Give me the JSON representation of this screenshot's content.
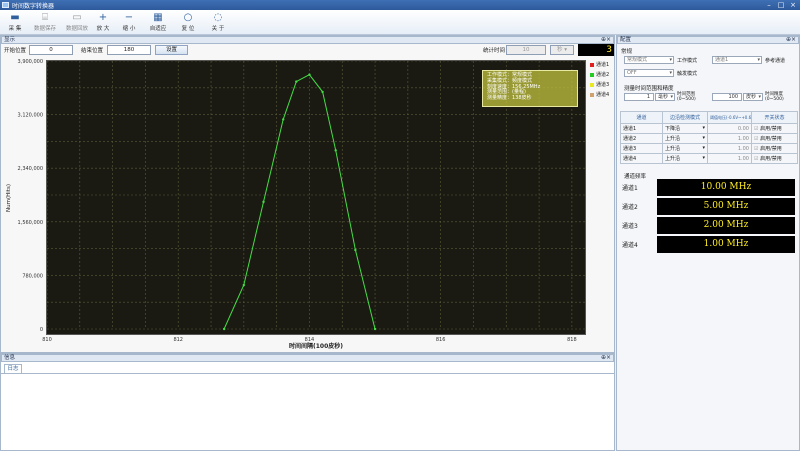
{
  "app": {
    "title": "时间数字转换器"
  },
  "toolbar": {
    "items": [
      {
        "label": "采 集",
        "icon": "acquire-icon",
        "enabled": true
      },
      {
        "label": "数据保存",
        "icon": "save-data-icon",
        "enabled": false
      },
      {
        "label": "数据回放",
        "icon": "playback-icon",
        "enabled": false
      },
      {
        "label": "放 大",
        "icon": "zoom-in-icon",
        "enabled": true
      },
      {
        "label": "缩 小",
        "icon": "zoom-out-icon",
        "enabled": true
      },
      {
        "label": "自适应",
        "icon": "auto-fit-icon",
        "enabled": true
      },
      {
        "label": "复 位",
        "icon": "reset-icon",
        "enabled": true
      },
      {
        "label": "关 于",
        "icon": "about-icon",
        "enabled": true
      }
    ]
  },
  "display": {
    "panel_title": "显示",
    "start_label": "开始位置",
    "start_value": "0",
    "end_label": "结束位置",
    "end_value": "180",
    "set_button": "设置",
    "stat_label": "统计时间",
    "stat_value": "10",
    "stat_unit": "秒",
    "counter": "3"
  },
  "legend": {
    "items": [
      {
        "label": "通道1",
        "color": "#e02020"
      },
      {
        "label": "通道2",
        "color": "#22cc22"
      },
      {
        "label": "通道3",
        "color": "#e8e820"
      },
      {
        "label": "通道4",
        "color": "#d0a070"
      }
    ]
  },
  "infobox": {
    "lines": [
      "工作模式：常规模式",
      "采集模式：频度模式",
      "刻度速度：156.25MHz",
      "测量范围：(量程)",
      "测量精度：138皮秒"
    ]
  },
  "chart_data": {
    "type": "line",
    "title": "",
    "xlabel": "时间间隔(100皮秒)",
    "ylabel": "Num(Hits)",
    "xlim": [
      810,
      818.2
    ],
    "ylim": [
      0,
      3900000
    ],
    "x_ticks": [
      "810",
      "812",
      "814",
      "816",
      "818"
    ],
    "y_ticks": [
      "0",
      "780,000",
      "1,560,000",
      "2,340,000",
      "3,120,000",
      "3,900,000"
    ],
    "grid": true,
    "series": [
      {
        "name": "通道2",
        "color": "#44dd44",
        "x": [
          812.7,
          813.0,
          813.3,
          813.6,
          813.8,
          814.0,
          814.2,
          814.4,
          814.7,
          815.0
        ],
        "y": [
          0,
          640000,
          1850000,
          3050000,
          3600000,
          3700000,
          3450000,
          2600000,
          1150000,
          0
        ]
      }
    ]
  },
  "info_panel": {
    "title": "信息",
    "tab": "日志"
  },
  "settings": {
    "panel_title": "配置",
    "general_label": "常规",
    "work_mode_value": "常规模式",
    "work_mode_label": "工作模式",
    "trigger_channel_value": "通道1",
    "trigger_channel_label": "参考通道",
    "trigger_mode_value": "OFF",
    "trigger_mode_label": "触发模式",
    "range_label": "测量时间范围和精度",
    "range_min": "1",
    "range_min_unit": "毫秒",
    "range_time_label": "时间范围",
    "range_time_sub": "(0~500)",
    "precision_value": "100",
    "precision_unit": "皮秒",
    "precision_label": "时间精度",
    "precision_sub": "(0~500)",
    "table_headers": [
      "通道",
      "边沿检测模式",
      "阈值电压(-0.6V~+0.6V)",
      "开关状态"
    ],
    "channels": [
      {
        "name": "通道1",
        "edge": "下降沿",
        "threshold": "0.00",
        "state": "启用/禁用"
      },
      {
        "name": "通道2",
        "edge": "上升沿",
        "threshold": "1.00",
        "state": "启用/禁用"
      },
      {
        "name": "通道3",
        "edge": "上升沿",
        "threshold": "1.00",
        "state": "启用/禁用"
      },
      {
        "name": "通道4",
        "edge": "上升沿",
        "threshold": "1.00",
        "state": "启用/禁用"
      }
    ],
    "freq_label": "通道频率",
    "freqs": [
      {
        "name": "通道1",
        "value": "10.00 MHz"
      },
      {
        "name": "通道2",
        "value": "5.00 MHz"
      },
      {
        "name": "通道3",
        "value": "2.00 MHz"
      },
      {
        "name": "通道4",
        "value": "1.00 MHz"
      }
    ]
  }
}
